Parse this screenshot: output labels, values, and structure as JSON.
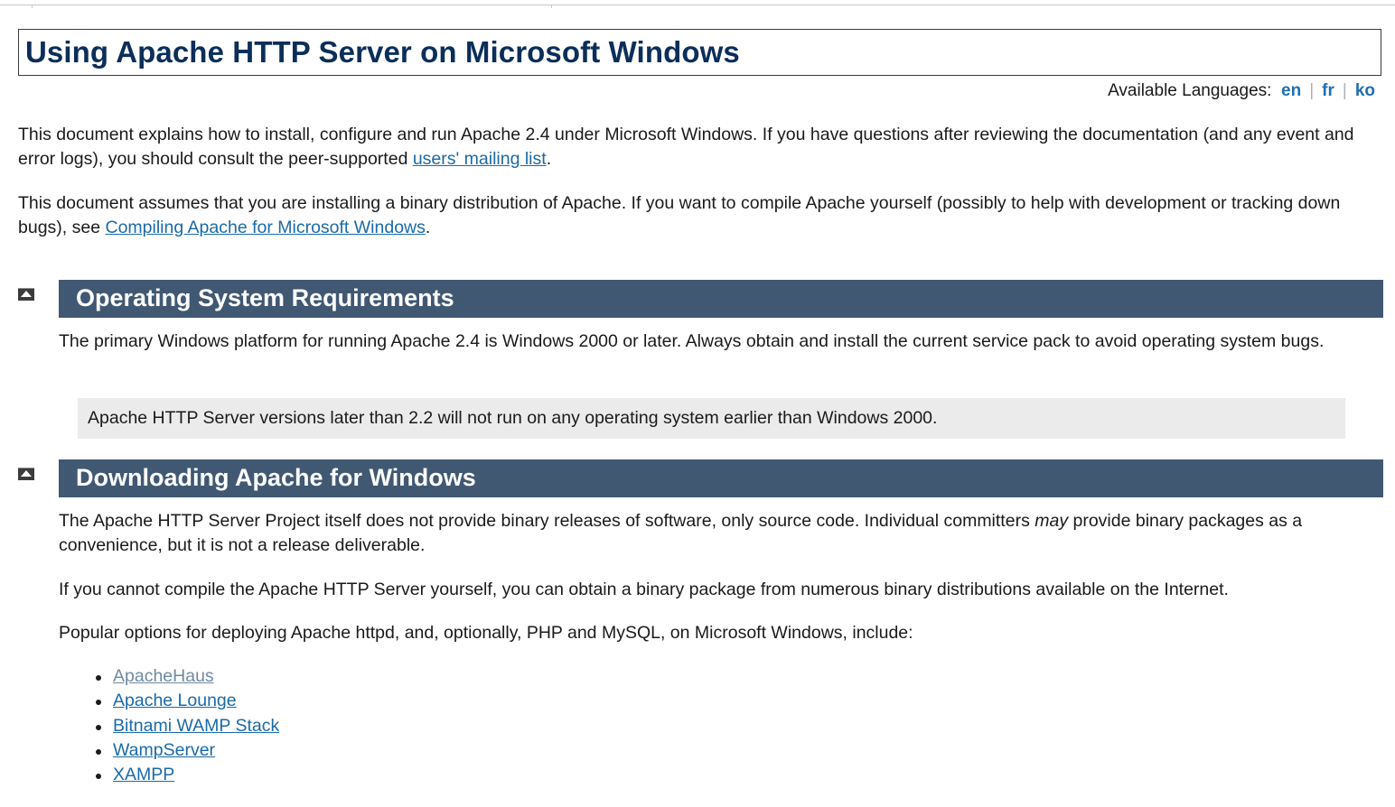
{
  "title": "Using Apache HTTP Server on Microsoft Windows",
  "languages": {
    "label": "Available Languages:",
    "items": [
      "en",
      "fr",
      "ko"
    ],
    "separator": "|"
  },
  "intro": {
    "p1_text": "This document explains how to install, configure and run Apache 2.4 under Microsoft Windows. If you have questions after reviewing the documentation (and any event and error logs), you should consult the peer-supported ",
    "p1_link": "users' mailing list",
    "p1_end": ".",
    "p2_text": "This document assumes that you are installing a binary distribution of Apache. If you want to compile Apache yourself (possibly to help with development or tracking down bugs), see ",
    "p2_link": "Compiling Apache for Microsoft Windows",
    "p2_end": "."
  },
  "sections": [
    {
      "heading": "Operating System Requirements",
      "p1": "The primary Windows platform for running Apache 2.4 is Windows 2000 or later. Always obtain and install the current service pack to avoid operating system bugs.",
      "note": "Apache HTTP Server versions later than 2.2 will not run on any operating system earlier than Windows 2000."
    },
    {
      "heading": "Downloading Apache for Windows",
      "p1_before": "The Apache HTTP Server Project itself does not provide binary releases of software, only source code. Individual committers ",
      "p1_em": "may",
      "p1_after": " provide binary packages as a convenience, but it is not a release deliverable.",
      "p2": "If you cannot compile the Apache HTTP Server yourself, you can obtain a binary package from numerous binary distributions available on the Internet.",
      "p3": "Popular options for deploying Apache httpd, and, optionally, PHP and MySQL, on Microsoft Windows, include:",
      "options": [
        "ApacheHaus",
        "Apache Lounge",
        "Bitnami WAMP Stack",
        "WampServer",
        "XAMPP"
      ]
    }
  ],
  "colors": {
    "title": "#0b2e5a",
    "section_bar": "#405872",
    "link": "#1a6aa8",
    "visited_link": "#6f8aa3",
    "note_bg": "#ebebeb"
  }
}
